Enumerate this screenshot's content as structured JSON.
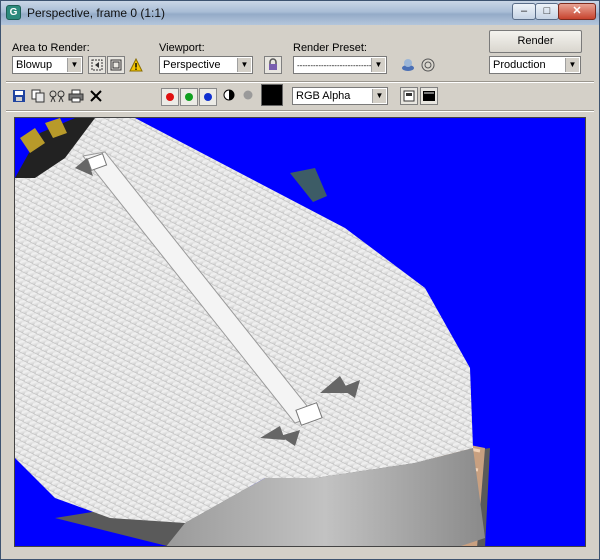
{
  "window": {
    "title": "Perspective, frame 0 (1:1)",
    "app_icon": "G"
  },
  "title_buttons": {
    "minimize": "–",
    "maximize": "□",
    "close": "✕"
  },
  "area": {
    "label": "Area to Render:",
    "value": "Blowup"
  },
  "viewport_select": {
    "label": "Viewport:",
    "value": "Perspective"
  },
  "preset": {
    "label": "Render Preset:",
    "value": "-----------------------------"
  },
  "render_button": "Render",
  "production": {
    "value": "Production"
  },
  "channel": {
    "value": "RGB Alpha"
  },
  "colors": {
    "red": "#e01010",
    "green": "#10a020",
    "blue": "#1030d0",
    "viewport_bg": "#0000ff"
  },
  "icons": [
    "save-icon",
    "copy-icon",
    "clone-icon",
    "print-icon",
    "clear-icon",
    "lock-icon",
    "warning-icon",
    "environment-icon",
    "teapot-icon",
    "mono-channel-icon",
    "alpha-channel-icon"
  ]
}
